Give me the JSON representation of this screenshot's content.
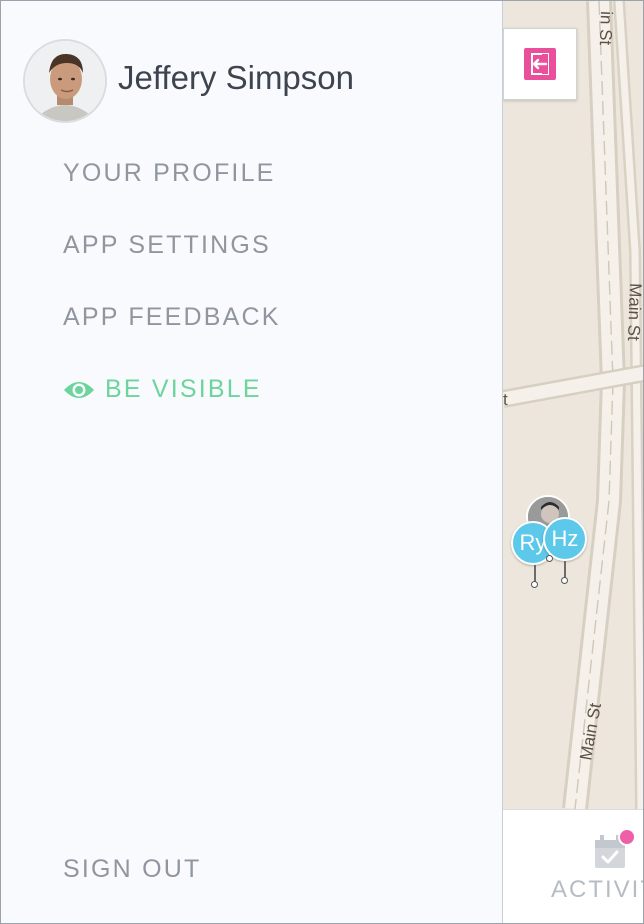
{
  "user": {
    "name": "Jeffery Simpson"
  },
  "menu": {
    "items": [
      {
        "label": "YOUR PROFILE"
      },
      {
        "label": "APP SETTINGS"
      },
      {
        "label": "APP FEEDBACK"
      }
    ],
    "visibility": {
      "label": "BE VISIBLE",
      "icon": "eye-icon",
      "color": "#6dd49c"
    },
    "sign_out": {
      "label": "SIGN OUT"
    }
  },
  "map": {
    "streets": [
      {
        "label": "Main St",
        "display": "in St"
      },
      {
        "label": "Main St",
        "display": "Main St"
      },
      {
        "label": "Main St",
        "display": "Main St"
      }
    ],
    "cross_street_label": "t",
    "pins": [
      {
        "initials": "Ry",
        "display": "Ry"
      },
      {
        "initials": "Hz",
        "display": "Hz"
      }
    ]
  },
  "tabbar": {
    "activity": {
      "label": "ACTIVIT",
      "icon": "calendar-check-icon",
      "badge_color": "#ee5fa7"
    }
  },
  "colors": {
    "accent_pink": "#ea4f9b",
    "pin_blue": "#5cc8ea",
    "drawer_bg": "#f9fafd",
    "map_bg": "#ece6dc"
  }
}
